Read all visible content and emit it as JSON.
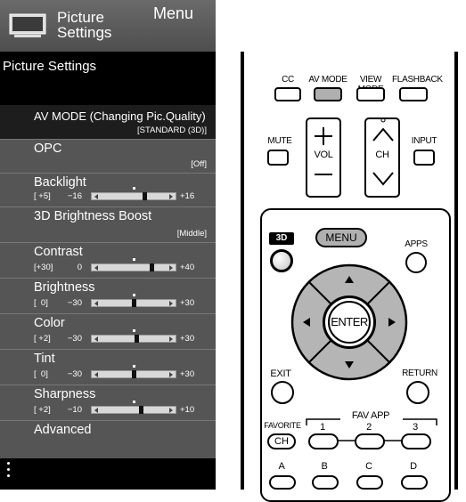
{
  "menu": {
    "header": {
      "title": "Picture\nSettings",
      "menu_label": "Menu"
    },
    "section_title": "Picture Settings",
    "items": [
      {
        "label": "AV MODE (Changing Pic.Quality)",
        "value": "[STANDARD (3D)]",
        "selected": true
      },
      {
        "label": "OPC",
        "value": "[Off]"
      },
      {
        "label": "Backlight",
        "current": "[ +5]",
        "min": "−16",
        "max": "+16",
        "level": 0.656
      },
      {
        "label": "3D Brightness Boost",
        "value": "[Middle]"
      },
      {
        "label": "Contrast",
        "current": "[+30]",
        "min": "0",
        "max": "+40",
        "level": 0.75
      },
      {
        "label": "Brightness",
        "current": "[  0]",
        "min": "−30",
        "max": "+30",
        "level": 0.5
      },
      {
        "label": "Color",
        "current": "[ +2]",
        "min": "−30",
        "max": "+30",
        "level": 0.533
      },
      {
        "label": "Tint",
        "current": "[  0]",
        "min": "−30",
        "max": "+30",
        "level": 0.5
      },
      {
        "label": "Sharpness",
        "current": "[ +2]",
        "min": "−10",
        "max": "+10",
        "level": 0.6
      },
      {
        "label": "Advanced"
      }
    ]
  },
  "remote": {
    "top_buttons": [
      "CC",
      "AV MODE",
      "VIEW MODE",
      "FLASHBACK"
    ],
    "mute": "MUTE",
    "vol": "VOL",
    "ch": "CH",
    "input": "INPUT",
    "three_d": "3D",
    "menu": "MENU",
    "apps": "APPS",
    "enter": "ENTER",
    "exit": "EXIT",
    "return": "RETURN",
    "favorite": "FAVORITE",
    "fav_ch": "CH",
    "fav_app": "FAV APP",
    "fav_numbers": [
      "1",
      "2",
      "3"
    ],
    "color_buttons": [
      "A",
      "B",
      "C",
      "D"
    ],
    "accent_gray": "#b0b0b0"
  }
}
